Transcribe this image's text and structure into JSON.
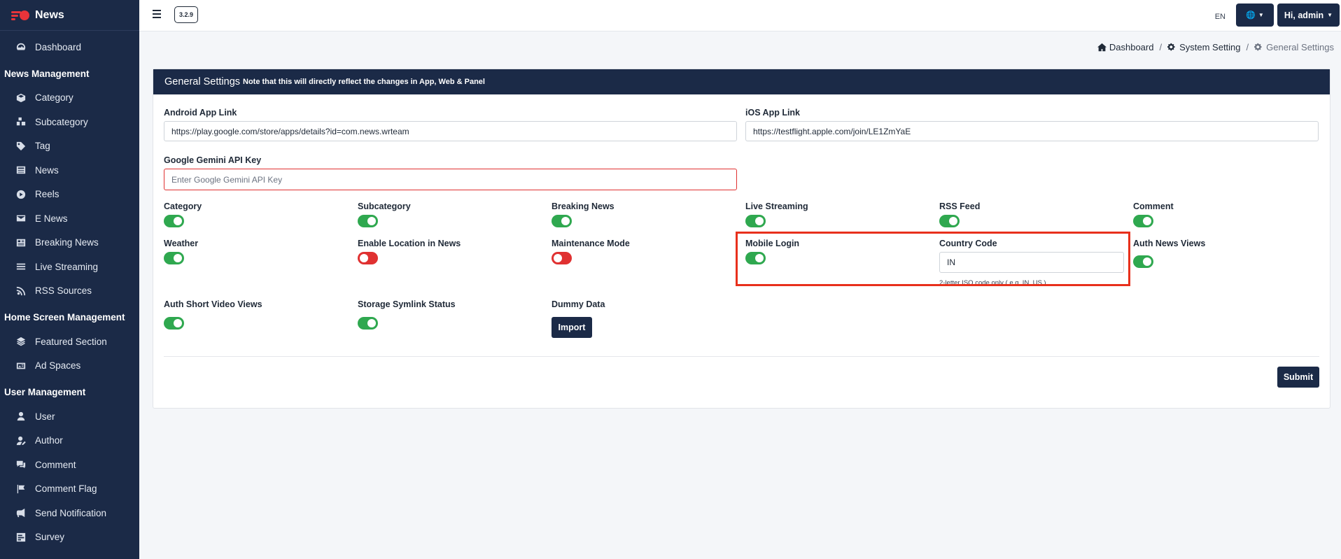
{
  "brand": {
    "name": "News"
  },
  "sidebar": {
    "dashboard": "Dashboard",
    "sections": [
      {
        "title": "News Management",
        "items": [
          "Category",
          "Subcategory",
          "Tag",
          "News",
          "Reels",
          "E News",
          "Breaking News",
          "Live Streaming",
          "RSS Sources"
        ]
      },
      {
        "title": "Home Screen Management",
        "items": [
          "Featured Section",
          "Ad Spaces"
        ]
      },
      {
        "title": "User Management",
        "items": [
          "User",
          "Author",
          "Comment",
          "Comment Flag",
          "Send Notification",
          "Survey"
        ]
      }
    ]
  },
  "topbar": {
    "version": "3.2.9",
    "lang_code": "EN",
    "user_greeting": "Hi, admin"
  },
  "breadcrumb": [
    "Dashboard",
    "System Setting",
    "General Settings"
  ],
  "card": {
    "title": "General Settings",
    "note": "Note that this will directly reflect the changes in App, Web & Panel",
    "android_label": "Android App Link",
    "android_value": "https://play.google.com/store/apps/details?id=com.news.wrteam",
    "ios_label": "iOS App Link",
    "ios_value": "https://testflight.apple.com/join/LE1ZmYaE",
    "gemini_label": "Google Gemini API Key",
    "gemini_placeholder": "Enter Google Gemini API Key",
    "toggles": {
      "category": {
        "label": "Category",
        "on": true
      },
      "subcategory": {
        "label": "Subcategory",
        "on": true
      },
      "breaking_news": {
        "label": "Breaking News",
        "on": true
      },
      "live_streaming": {
        "label": "Live Streaming",
        "on": true
      },
      "rss_feed": {
        "label": "RSS Feed",
        "on": true
      },
      "comment": {
        "label": "Comment",
        "on": true
      },
      "weather": {
        "label": "Weather",
        "on": true
      },
      "location": {
        "label": "Enable Location in News",
        "on": false
      },
      "maintenance": {
        "label": "Maintenance Mode",
        "on": false
      },
      "mobile_login": {
        "label": "Mobile Login",
        "on": true
      },
      "auth_news_views": {
        "label": "Auth News Views",
        "on": true
      },
      "auth_short_video_views": {
        "label": "Auth Short Video Views",
        "on": true
      },
      "storage_symlink": {
        "label": "Storage Symlink Status",
        "on": true
      }
    },
    "country_code_label": "Country Code",
    "country_code_value": "IN",
    "country_code_hint": "2-letter ISO code only ( e.g. IN, US )",
    "dummy_label": "Dummy Data",
    "import_label": "Import",
    "submit_label": "Submit"
  },
  "colors": {
    "navy": "#1b2a47",
    "toggle_on": "#2fa84f",
    "toggle_off": "#e03131",
    "highlight": "#e8301c"
  }
}
